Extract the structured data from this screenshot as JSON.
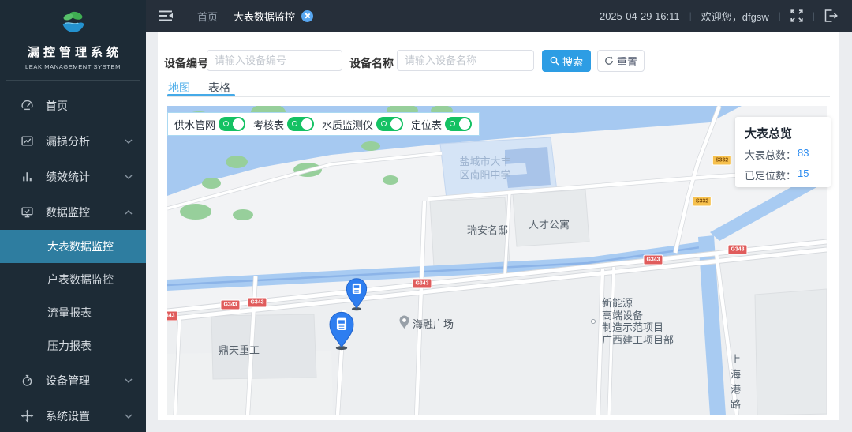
{
  "app": {
    "title": "漏控管理系统",
    "subtitle": "LEAK MANAGEMENT SYSTEM"
  },
  "sidebar": {
    "items": [
      {
        "label": "首页"
      },
      {
        "label": "漏损分析"
      },
      {
        "label": "绩效统计"
      },
      {
        "label": "数据监控"
      },
      {
        "label": "大表数据监控"
      },
      {
        "label": "户表数据监控"
      },
      {
        "label": "流量报表"
      },
      {
        "label": "压力报表"
      },
      {
        "label": "设备管理"
      },
      {
        "label": "系统设置"
      }
    ]
  },
  "topbar": {
    "breadcrumb_home": "首页",
    "breadcrumb_current": "大表数据监控",
    "datetime": "2025-04-29 16:11",
    "welcome": "欢迎您，dfgsw"
  },
  "search": {
    "code_label": "设备编号",
    "code_placeholder": "请输入设备编号",
    "name_label": "设备名称",
    "name_placeholder": "请输入设备名称",
    "search_button": "搜索",
    "reset_button": "重置"
  },
  "tabs": {
    "map": "地图",
    "table": "表格"
  },
  "map_controls": {
    "toggles": [
      {
        "label": "供水管网",
        "state": "on"
      },
      {
        "label": "考核表",
        "state": "on"
      },
      {
        "label": "水质监测仪",
        "state": "on"
      },
      {
        "label": "定位表",
        "state": "on"
      }
    ]
  },
  "overview": {
    "title": "大表总览",
    "total_label": "大表总数：",
    "total_value": "83",
    "located_label": "已定位数：",
    "located_value": "15"
  },
  "map": {
    "labels": {
      "school_line1": "盐城市大丰",
      "school_line2": "区南阳中学",
      "estate": "瑞安名邸",
      "apartment": "人才公寓",
      "plaza": "海融广场",
      "factory": "鼎天重工",
      "project_line1": "新能源",
      "project_line2": "高端设备",
      "project_line3": "制造示范项目",
      "project_line4": "广西建工项目部",
      "road": "上海港路"
    },
    "badges": {
      "g343": "G343",
      "s332": "S332"
    }
  },
  "colors": {
    "sidebar_bg": "#1d2b36",
    "topbar_bg": "#262f3a",
    "active_menu": "#2e7da0",
    "primary_blue": "#2d9de4",
    "tab_active": "#53b0ea",
    "toggle_green": "#14c163",
    "value_blue": "#2d8cf0",
    "badge_red": "#e05c5c",
    "badge_yellow": "#f6c04d",
    "pin_blue": "#2e7ef0"
  }
}
